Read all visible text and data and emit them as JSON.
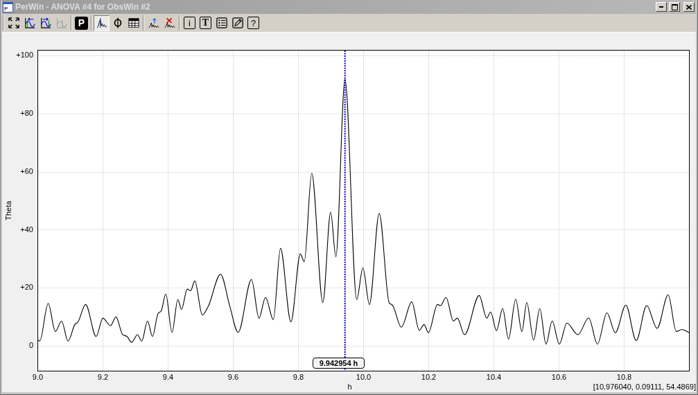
{
  "window": {
    "icon_label": "P",
    "title": "PerWin - ANOVA #4 for ObsWin #2"
  },
  "toolbar": {
    "groups": [
      {
        "buttons": [
          {
            "kind": "fit",
            "pressed": false,
            "disabled": false
          },
          {
            "kind": "shift_left",
            "pressed": false,
            "disabled": false
          },
          {
            "kind": "shift_right",
            "pressed": false,
            "disabled": false
          },
          {
            "kind": "graph",
            "pressed": false,
            "disabled": true
          }
        ]
      },
      {
        "buttons": [
          {
            "kind": "p_box",
            "label": "P",
            "pressed": false,
            "disabled": false
          }
        ]
      },
      {
        "buttons": [
          {
            "kind": "peaks",
            "pressed": true,
            "disabled": false
          },
          {
            "kind": "phase",
            "pressed": false,
            "disabled": false
          },
          {
            "kind": "table",
            "pressed": false,
            "disabled": false
          }
        ]
      },
      {
        "buttons": [
          {
            "kind": "peaks_mark",
            "pressed": false,
            "disabled": false
          },
          {
            "kind": "peaks_delete",
            "pressed": false,
            "disabled": false
          }
        ]
      },
      {
        "buttons": [
          {
            "kind": "info",
            "label": "i",
            "pressed": false,
            "disabled": false
          },
          {
            "kind": "text_tool",
            "label": "T",
            "pressed": false,
            "disabled": false
          },
          {
            "kind": "list",
            "pressed": false,
            "disabled": false
          },
          {
            "kind": "pencil",
            "pressed": false,
            "disabled": false
          },
          {
            "kind": "help",
            "label": "?",
            "pressed": false,
            "disabled": false
          }
        ]
      }
    ]
  },
  "chart": {
    "chart_data": {
      "type": "line",
      "xlabel": "h",
      "ylabel": "Theta",
      "grid": true,
      "x": [
        9.0,
        9.006,
        9.032,
        9.054,
        9.073,
        9.093,
        9.115,
        9.122,
        9.147,
        9.179,
        9.2,
        9.223,
        9.24,
        9.261,
        9.274,
        9.288,
        9.306,
        9.319,
        9.337,
        9.352,
        9.37,
        9.378,
        9.393,
        9.412,
        9.43,
        9.441,
        9.459,
        9.469,
        9.482,
        9.505,
        9.523,
        9.561,
        9.589,
        9.615,
        9.656,
        9.679,
        9.699,
        9.723,
        9.745,
        9.777,
        9.806,
        9.818,
        9.841,
        9.875,
        9.899,
        9.915,
        9.943,
        9.979,
        9.998,
        10.018,
        10.048,
        10.079,
        10.089,
        10.116,
        10.148,
        10.171,
        10.186,
        10.199,
        10.227,
        10.236,
        10.253,
        10.276,
        10.288,
        10.31,
        10.355,
        10.378,
        10.39,
        10.408,
        10.427,
        10.445,
        10.467,
        10.486,
        10.501,
        10.522,
        10.541,
        10.56,
        10.579,
        10.601,
        10.624,
        10.658,
        10.691,
        10.718,
        10.747,
        10.773,
        10.805,
        10.837,
        10.869,
        10.901,
        10.935,
        10.96,
        10.977,
        11.0
      ],
      "series": [
        {
          "color": "#000000",
          "values": [
            2.1,
            1.7,
            14.7,
            5.0,
            8.6,
            1.7,
            7.6,
            8.1,
            14.3,
            3.3,
            9.6,
            7.0,
            10.0,
            3.9,
            3.3,
            1.3,
            3.9,
            1.7,
            8.6,
            3.3,
            11.4,
            11.9,
            17.9,
            4.7,
            16.0,
            12.6,
            19.6,
            19.0,
            22.4,
            10.7,
            13.6,
            24.7,
            13.9,
            4.7,
            22.9,
            9.6,
            16.7,
            9.1,
            33.6,
            8.3,
            31.7,
            29.0,
            59.4,
            15.0,
            46.0,
            30.7,
            91.8,
            16.0,
            26.9,
            14.3,
            45.6,
            14.8,
            14.0,
            6.5,
            15.2,
            5.4,
            7.4,
            4.6,
            14.3,
            13.9,
            16.7,
            8.6,
            9.6,
            3.9,
            17.4,
            9.6,
            11.7,
            5.3,
            12.9,
            2.4,
            16.1,
            5.0,
            15.0,
            2.1,
            12.9,
            0.7,
            8.6,
            0.7,
            7.9,
            3.9,
            9.7,
            0.7,
            11.4,
            4.6,
            14.1,
            1.9,
            13.9,
            6.1,
            17.6,
            5.0,
            5.7,
            4.6
          ]
        }
      ],
      "xlim": [
        9.0,
        11.0
      ],
      "ylim": [
        -8.6,
        101.7
      ],
      "xticks": [
        {
          "value": 9.0,
          "label": "9.0"
        },
        {
          "value": 9.2,
          "label": "9.2"
        },
        {
          "value": 9.4,
          "label": "9.4"
        },
        {
          "value": 9.6,
          "label": "9.6"
        },
        {
          "value": 9.8,
          "label": "9.8"
        },
        {
          "value": 10.0,
          "label": "10.0"
        },
        {
          "value": 10.2,
          "label": "10.2"
        },
        {
          "value": 10.4,
          "label": "10.4"
        },
        {
          "value": 10.6,
          "label": "10.6"
        },
        {
          "value": 10.8,
          "label": "10.8"
        }
      ],
      "yticks": [
        {
          "value": 100,
          "label": "+100"
        },
        {
          "value": 80,
          "label": "+80"
        },
        {
          "value": 60,
          "label": "+60"
        },
        {
          "value": 40,
          "label": "+40"
        },
        {
          "value": 20,
          "label": "+20"
        },
        {
          "value": 0,
          "label": "0"
        }
      ],
      "ref_lines": [
        {
          "axis": "x",
          "value": 9.942954,
          "color": "#0000c0"
        }
      ],
      "annotations": [
        "9.942954 h"
      ]
    }
  },
  "status_bar": {
    "text": "[10.976040, 0.09111, 54.4869]"
  }
}
